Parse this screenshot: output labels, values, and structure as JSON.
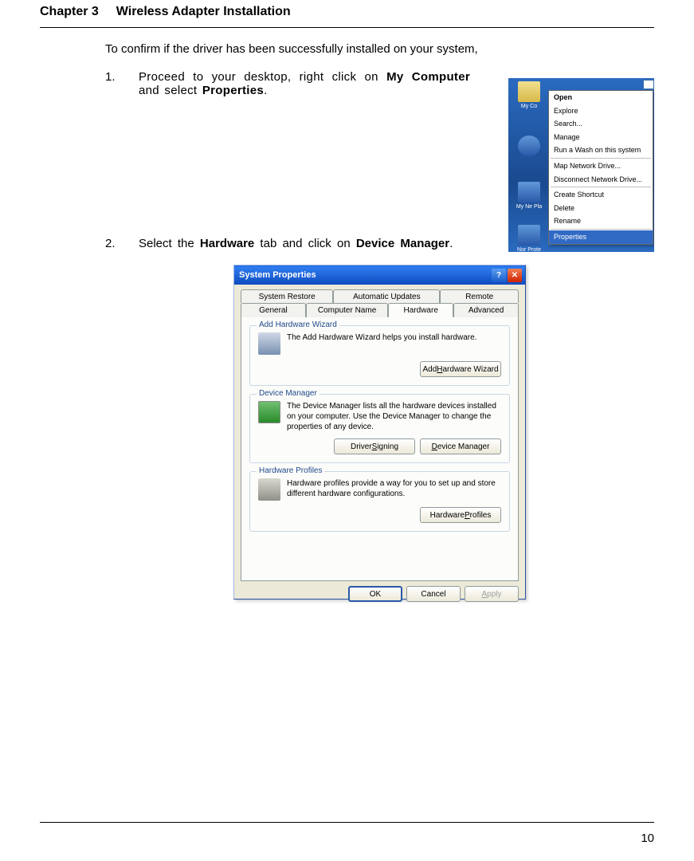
{
  "header": {
    "chapter": "Chapter 3",
    "title": "Wireless Adapter Installation"
  },
  "intro": "To confirm if the driver has been successfully installed on your system,",
  "steps": {
    "s1": {
      "num": "1.",
      "pre": "Proceed to your desktop, right click on ",
      "bold1": "My Computer",
      "mid": " and select ",
      "bold2": "Properties",
      "post": "."
    },
    "s2": {
      "num": "2.",
      "pre": "Select the ",
      "bold1": "Hardware",
      "mid": " tab and click on ",
      "bold2": "Device Manager",
      "post": "."
    }
  },
  "desktop": {
    "icons": {
      "a": "My Co",
      "b": "",
      "c": "My Ne\nPla",
      "d": "Nor\nProte"
    }
  },
  "context_menu": {
    "items": [
      "Open",
      "Explore",
      "Search...",
      "Manage",
      "Run a Wash on this system",
      "_sep",
      "Map Network Drive...",
      "Disconnect Network Drive...",
      "_sep",
      "Create Shortcut",
      "Delete",
      "Rename",
      "_sep",
      "Properties"
    ],
    "selected": "Properties"
  },
  "dialog": {
    "title": "System Properties",
    "help": "?",
    "close": "✕",
    "tabs_top": [
      "System Restore",
      "Automatic Updates",
      "Remote"
    ],
    "tabs_bottom": [
      "General",
      "Computer Name",
      "Hardware",
      "Advanced"
    ],
    "active_tab": "Hardware",
    "fieldsets": {
      "wizard": {
        "legend": "Add Hardware Wizard",
        "text": "The Add Hardware Wizard helps you install hardware.",
        "button_pre": "Add ",
        "button_ul": "H",
        "button_post": "ardware Wizard"
      },
      "devmgr": {
        "legend": "Device Manager",
        "text": "The Device Manager lists all the hardware devices installed on your computer. Use the Device Manager to change the properties of any device.",
        "btn1_pre": "Driver ",
        "btn1_ul": "S",
        "btn1_post": "igning",
        "btn2_ul": "D",
        "btn2_post": "evice Manager"
      },
      "profiles": {
        "legend": "Hardware Profiles",
        "text": "Hardware profiles provide a way for you to set up and store different hardware configurations.",
        "button_pre": "Hardware ",
        "button_ul": "P",
        "button_post": "rofiles"
      }
    },
    "buttons": {
      "ok": "OK",
      "cancel": "Cancel",
      "apply_ul": "A",
      "apply_post": "pply"
    }
  },
  "page_number": "10"
}
